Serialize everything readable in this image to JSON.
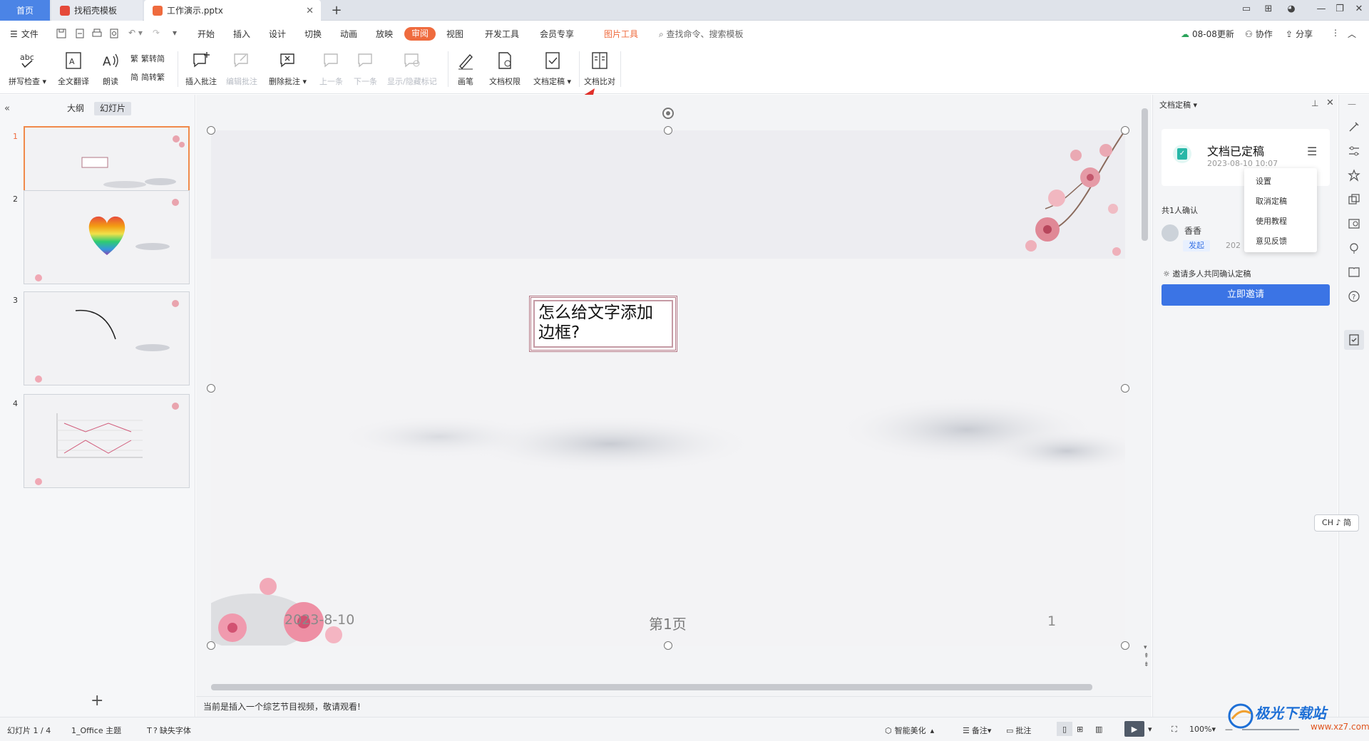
{
  "tabs": {
    "home": "首页",
    "template": "找稻壳模板",
    "document": "工作演示.pptx"
  },
  "menu": {
    "file": "文件",
    "items": [
      "开始",
      "插入",
      "设计",
      "切换",
      "动画",
      "放映",
      "审阅",
      "视图",
      "开发工具",
      "会员专享"
    ],
    "picture_tools": "图片工具",
    "search_placeholder": "查找命令、搜索模板",
    "update": "08-08更新",
    "collab": "协作",
    "share": "分享"
  },
  "ribbon": {
    "spell_check": "拼写检查",
    "translate": "全文翻译",
    "read_aloud": "朗读",
    "trad_to_simp": "繁转简",
    "simp_to_trad": "简转繁",
    "insert_comment": "插入批注",
    "edit_comment": "编辑批注",
    "delete_comment": "删除批注",
    "prev": "上一条",
    "next": "下一条",
    "show_hide_marks": "显示/隐藏标记",
    "pen": "画笔",
    "doc_permission": "文档权限",
    "doc_finalize": "文档定稿",
    "doc_compare": "文档比对"
  },
  "left_panel": {
    "outline_tab": "大纲",
    "slides_tab": "幻灯片",
    "slide_numbers": [
      "1",
      "2",
      "3",
      "4"
    ]
  },
  "slide": {
    "text": "怎么给文字添加边框?",
    "date": "2023-8-10",
    "footer": "第1页",
    "number": "1"
  },
  "notes": "当前是插入一个综艺节目视频，敬请观看!",
  "task_pane": {
    "title": "文档定稿",
    "status": "文档已定稿",
    "date": "2023-08-10 10:07",
    "menu_items": [
      "设置",
      "取消定稿",
      "使用教程",
      "意见反馈"
    ],
    "confirm_count": "共1人确认",
    "user": "香香",
    "badge": "发起",
    "year": "202",
    "invite_text": "邀请多人共同确认定稿",
    "invite_button": "立即邀请"
  },
  "ime": "CH ♪ 简",
  "status_bar": {
    "slide_info": "幻灯片 1 / 4",
    "theme": "1_Office 主题",
    "missing_font": "缺失字体",
    "beautify": "智能美化",
    "notes": "备注",
    "comments": "批注",
    "zoom": "100%"
  },
  "watermark": {
    "brand": "极光下载站",
    "url": "www.xz7.com"
  },
  "colors": {
    "accent_orange": "#ef6b3e",
    "home_tab_blue": "#4b84e6",
    "invite_blue": "#3b74e5",
    "selection_orange": "#f08a4b"
  }
}
